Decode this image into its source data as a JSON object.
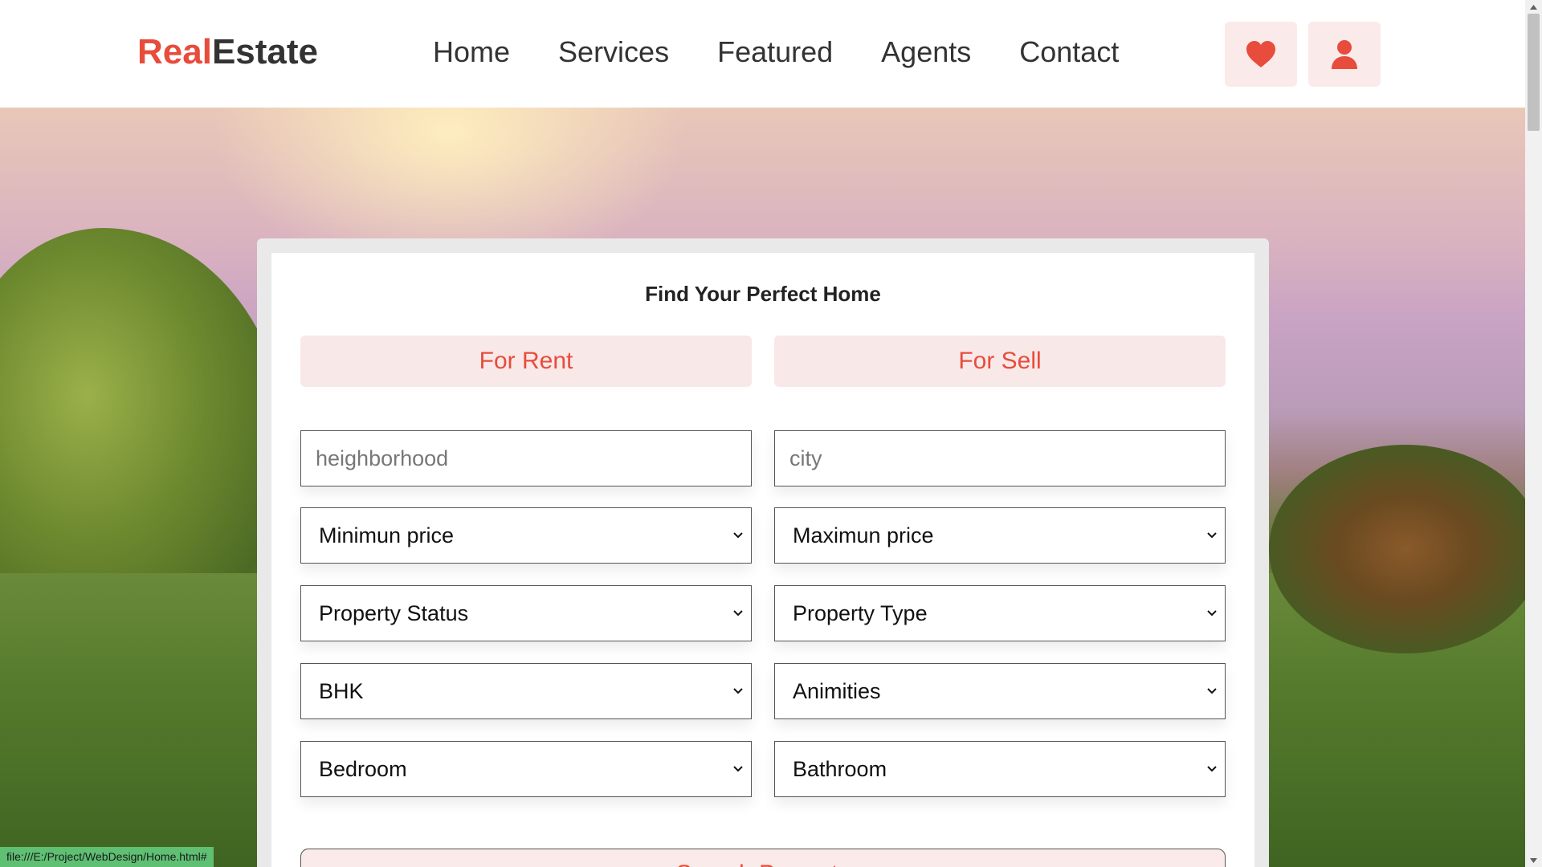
{
  "header": {
    "logo_part1": "Real",
    "logo_part2": "Estate",
    "nav": [
      "Home",
      "Services",
      "Featured",
      "Agents",
      "Contact"
    ],
    "icons": [
      "heart-icon",
      "user-icon"
    ]
  },
  "colors": {
    "accent": "#e74c3c",
    "accent_light": "#fbeaea",
    "status_bar": "#5fbf73"
  },
  "search_card": {
    "title": "Find Your Perfect Home",
    "tabs": [
      "For Rent",
      "For Sell"
    ],
    "inputs": {
      "neighborhood_placeholder": "heighborhood",
      "city_placeholder": "city"
    },
    "selects": {
      "min_price": "Minimun price",
      "max_price": "Maximun price",
      "property_status": "Property Status",
      "property_type": "Property Type",
      "bhk": "BHK",
      "amenities": "Animities",
      "bedroom": "Bedroom",
      "bathroom": "Bathroom"
    },
    "search_button": "Search Property"
  },
  "status_bar": {
    "url": "file:///E:/Project/WebDesign/Home.html#"
  }
}
